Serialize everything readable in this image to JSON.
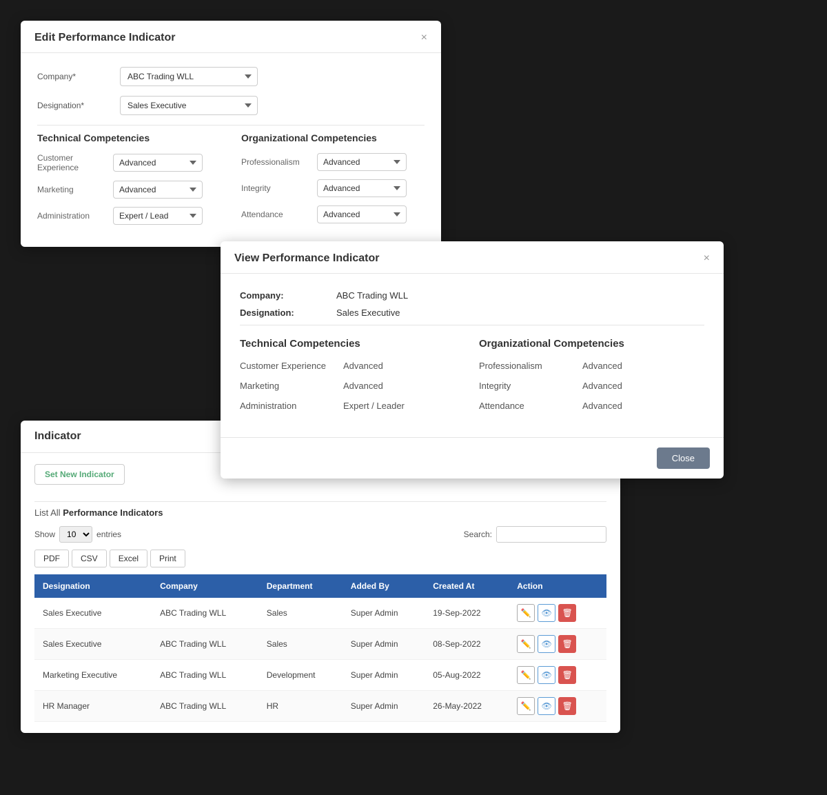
{
  "editModal": {
    "title": "Edit Performance Indicator",
    "company_label": "Company*",
    "company_value": "ABC Trading WLL",
    "designation_label": "Designation*",
    "designation_value": "Sales Executive",
    "technical_heading": "Technical Competencies",
    "organizational_heading": "Organizational Competencies",
    "technical_rows": [
      {
        "label": "Customer Experience",
        "value": "Advanced"
      },
      {
        "label": "Marketing",
        "value": "Advanced"
      },
      {
        "label": "Administration",
        "value": "Expert / Lead"
      }
    ],
    "organizational_rows": [
      {
        "label": "Professionalism",
        "value": "Advanced"
      },
      {
        "label": "Integrity",
        "value": "Advanced"
      },
      {
        "label": "Attendance",
        "value": "Advanced"
      }
    ],
    "close_icon": "×"
  },
  "viewModal": {
    "title": "View Performance Indicator",
    "company_label": "Company:",
    "company_value": "ABC Trading WLL",
    "designation_label": "Designation:",
    "designation_value": "Sales Executive",
    "technical_heading": "Technical Competencies",
    "organizational_heading": "Organizational Competencies",
    "technical_rows": [
      {
        "label": "Customer Experience",
        "value": "Advanced"
      },
      {
        "label": "Marketing",
        "value": "Advanced"
      },
      {
        "label": "Administration",
        "value": "Expert / Leader"
      }
    ],
    "organizational_rows": [
      {
        "label": "Professionalism",
        "value": "Advanced"
      },
      {
        "label": "Integrity",
        "value": "Advanced"
      },
      {
        "label": "Attendance",
        "value": "Advanced"
      }
    ],
    "close_btn": "Close",
    "close_icon": "×"
  },
  "indicatorPanel": {
    "title": "Indicator",
    "set_new_btn": "Set New Indicator",
    "list_label_prefix": "List All",
    "list_label_suffix": "Performance Indicators",
    "show_label": "Show",
    "show_value": "10",
    "entries_label": "entries",
    "search_label": "Search:",
    "search_placeholder": "",
    "export_btns": [
      "PDF",
      "CSV",
      "Excel",
      "Print"
    ],
    "table_headers": [
      "Designation",
      "Company",
      "Department",
      "Added By",
      "Created At",
      "Action"
    ],
    "table_rows": [
      {
        "designation": "Sales Executive",
        "company": "ABC Trading WLL",
        "department": "Sales",
        "added_by": "Super Admin",
        "created_at": "19-Sep-2022"
      },
      {
        "designation": "Sales Executive",
        "company": "ABC Trading WLL",
        "department": "Sales",
        "added_by": "Super Admin",
        "created_at": "08-Sep-2022"
      },
      {
        "designation": "Marketing Executive",
        "company": "ABC Trading WLL",
        "department": "Development",
        "added_by": "Super Admin",
        "created_at": "05-Aug-2022"
      },
      {
        "designation": "HR Manager",
        "company": "ABC Trading WLL",
        "department": "HR",
        "added_by": "Super Admin",
        "created_at": "26-May-2022"
      }
    ]
  }
}
